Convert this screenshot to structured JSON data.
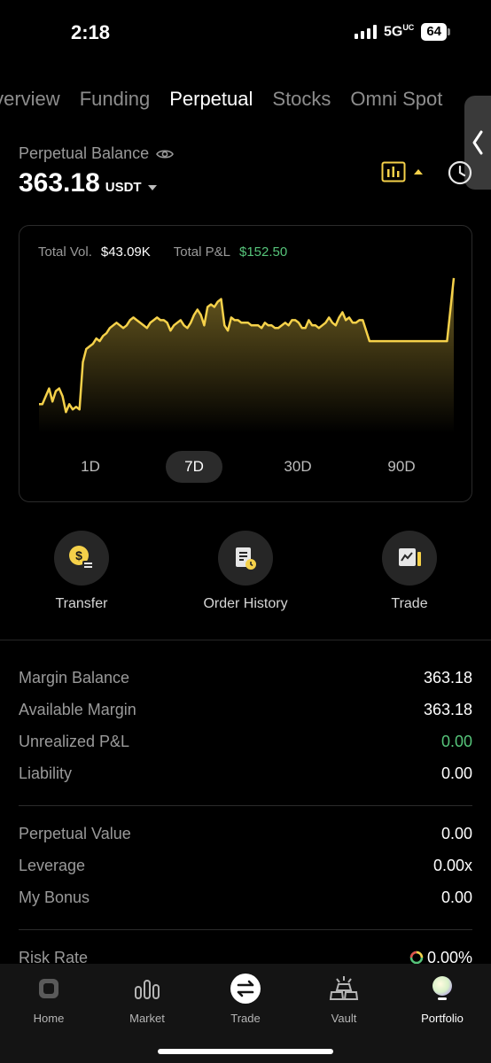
{
  "status": {
    "time": "2:18",
    "network": "5G",
    "network_sup": "UC",
    "battery": "64"
  },
  "tabs": [
    {
      "label": "Overview"
    },
    {
      "label": "Funding"
    },
    {
      "label": "Perpetual"
    },
    {
      "label": "Stocks"
    },
    {
      "label": "Omni Spot"
    }
  ],
  "active_tab": "Perpetual",
  "balance": {
    "label": "Perpetual Balance",
    "value": "363.18",
    "unit": "USDT"
  },
  "chart_card": {
    "vol_label": "Total Vol.",
    "vol_value": "$43.09K",
    "pnl_label": "Total P&L",
    "pnl_value": "$152.50",
    "periods": [
      "1D",
      "7D",
      "30D",
      "90D"
    ],
    "active_period": "7D"
  },
  "chart_data": {
    "type": "area",
    "values": [
      24,
      24,
      27,
      30,
      25,
      29,
      30,
      27,
      21,
      24,
      22,
      23,
      22,
      40,
      45,
      46,
      47,
      49,
      48,
      50,
      51,
      53,
      54,
      55,
      54,
      53,
      54,
      56,
      57,
      56,
      55,
      54,
      53,
      55,
      56,
      57,
      56,
      56,
      55,
      52,
      54,
      55,
      56,
      54,
      53,
      55,
      58,
      60,
      58,
      54,
      61,
      62,
      61,
      63,
      64,
      54,
      52,
      57,
      56,
      56,
      55,
      55,
      55,
      54,
      54,
      54,
      53,
      55,
      54,
      54,
      53,
      53,
      54,
      55,
      54,
      56,
      56,
      55,
      53,
      53,
      56,
      54,
      54,
      53,
      54,
      55,
      57,
      55,
      54,
      57,
      59,
      56,
      57,
      55,
      55,
      56,
      56,
      52,
      48,
      48,
      48,
      48,
      48,
      48,
      48,
      48,
      48,
      48,
      48,
      48,
      48,
      48,
      48,
      48,
      48,
      48,
      48,
      48,
      48,
      48,
      48,
      48,
      60,
      72
    ],
    "accent": "#f5d14a"
  },
  "actions": [
    {
      "label": "Transfer",
      "icon": "transfer-icon"
    },
    {
      "label": "Order History",
      "icon": "order-history-icon"
    },
    {
      "label": "Trade",
      "icon": "trade-chart-icon"
    }
  ],
  "margin": [
    {
      "key": "Margin Balance",
      "value": "363.18"
    },
    {
      "key": "Available Margin",
      "value": "363.18"
    },
    {
      "key": "Unrealized P&L",
      "value": "0.00",
      "color": "#56c47a"
    },
    {
      "key": "Liability",
      "value": "0.00"
    }
  ],
  "perp": [
    {
      "key": "Perpetual Value",
      "value": "0.00"
    },
    {
      "key": "Leverage",
      "value": "0.00x"
    },
    {
      "key": "My Bonus",
      "value": "0.00"
    }
  ],
  "risk": {
    "key": "Risk Rate",
    "value": "0.00%"
  },
  "nav": [
    {
      "label": "Home",
      "icon": "home-icon"
    },
    {
      "label": "Market",
      "icon": "market-icon"
    },
    {
      "label": "Trade",
      "icon": "trade-icon"
    },
    {
      "label": "Vault",
      "icon": "vault-icon"
    },
    {
      "label": "Portfolio",
      "icon": "portfolio-icon"
    }
  ],
  "active_nav": "Portfolio"
}
